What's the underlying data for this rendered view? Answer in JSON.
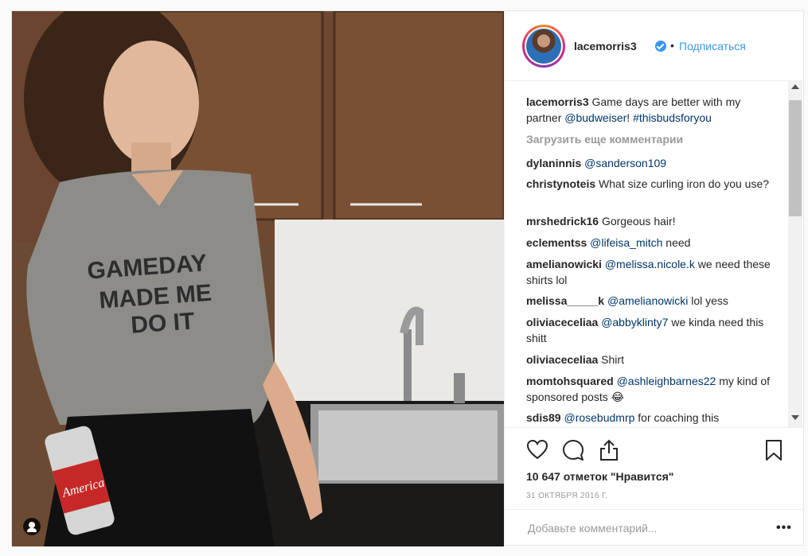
{
  "post": {
    "username": "lacemorris3",
    "follow_label": "Подписаться",
    "separator": "•",
    "caption": {
      "username": "lacemorris3",
      "text_1": " Game days are better with my partner ",
      "mention": "@budweiser",
      "text_2": "! ",
      "hashtag": "#thisbudsforyou"
    },
    "load_more_label": "Загрузить еще комментарии",
    "comments": [
      {
        "user": "dylaninnis",
        "mention": "@sanderson109",
        "text": ""
      },
      {
        "user": "christynoteis",
        "mention": "",
        "text": " What size curling iron do you use?"
      },
      {
        "user": "mrshedrick16",
        "mention": "",
        "text": " Gorgeous hair!"
      },
      {
        "user": "eclementss",
        "mention": "@lifeisa_mitch",
        "text": " need"
      },
      {
        "user": "amelianowicki",
        "mention": "@melissa.nicole.k",
        "text": " we need these shirts lol"
      },
      {
        "user": "melissa_____k",
        "mention": "@amelianowicki",
        "text": " lol yess"
      },
      {
        "user": "oliviaceceliaa",
        "mention": "@abbyklinty7",
        "text": " we kinda need this shitt"
      },
      {
        "user": "oliviaceceliaa",
        "mention": "",
        "text": " Shirt"
      },
      {
        "user": "momtohsquared",
        "mention": "@ashleighbarnes22",
        "text": " my kind of sponsored posts 😂"
      },
      {
        "user": "sdis89",
        "mention": "@rosebudmrp",
        "text": " for coaching this"
      }
    ],
    "likes_text": "10 647 отметок \"Нравится\"",
    "date_text": "31 ОКТЯБРЯ 2016 Г.",
    "comment_placeholder": "Добавьте комментарий...",
    "more_options": "•••",
    "shirt_text": [
      "GAMEDAY",
      "MADE ME",
      "DO IT"
    ],
    "can_text": "America"
  },
  "colors": {
    "link": "#3897f0",
    "mention": "#003569",
    "muted": "#999999",
    "verified": "#3897f0"
  },
  "icons": [
    "heart-icon",
    "comment-icon",
    "share-icon",
    "bookmark-icon",
    "verified-icon",
    "user-tag-icon"
  ]
}
